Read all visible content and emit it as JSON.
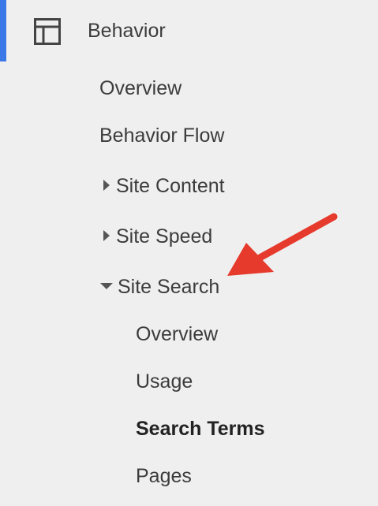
{
  "section": {
    "label": "Behavior",
    "icon": "layout-icon",
    "accent_color": "#3b78e7"
  },
  "items": [
    {
      "label": "Overview"
    },
    {
      "label": "Behavior Flow"
    },
    {
      "label": "Site Content",
      "state": "collapsed"
    },
    {
      "label": "Site Speed",
      "state": "collapsed"
    },
    {
      "label": "Site Search",
      "state": "expanded"
    }
  ],
  "site_search_items": [
    {
      "label": "Overview"
    },
    {
      "label": "Usage"
    },
    {
      "label": "Search Terms",
      "active": true
    },
    {
      "label": "Pages"
    }
  ],
  "annotation": {
    "icon": "red-arrow-icon",
    "color": "#e53a2c"
  }
}
